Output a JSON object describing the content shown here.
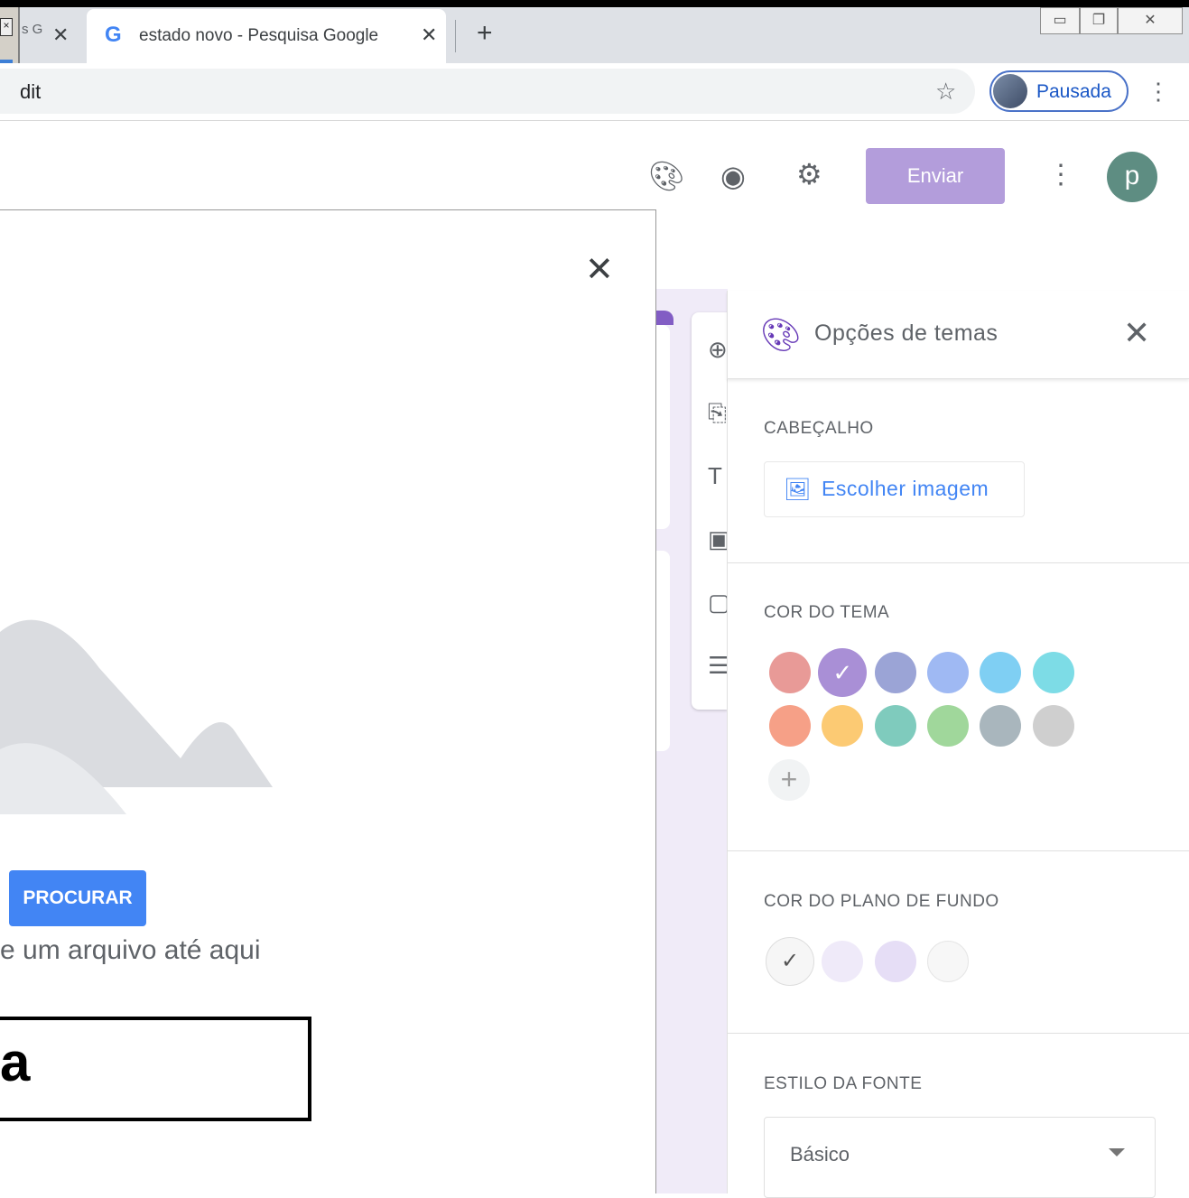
{
  "browser": {
    "tabs": [
      {
        "title_fragment": "s G"
      },
      {
        "title": "estado novo - Pesquisa Google"
      }
    ],
    "url_fragment": "dit",
    "profile_label": "Pausada"
  },
  "forms_header": {
    "send_label": "Enviar",
    "avatar_letter": "p"
  },
  "upload_dialog": {
    "browse_label": "PROCURAR",
    "drag_text": "e um arquivo até aqui",
    "annotation_text": "a"
  },
  "theme_panel": {
    "title": "Opções de temas",
    "header_section": {
      "label": "CABEÇALHO",
      "choose_image_label": "Escolher imagem"
    },
    "theme_color_section": {
      "label": "COR DO TEMA",
      "colors": [
        "#e89a97",
        "#a98fd6",
        "#9ba4d6",
        "#9fb9f3",
        "#7fcff3",
        "#7ddce6",
        "#f6a087",
        "#fcca73",
        "#7fcbbd",
        "#a0d79b",
        "#a9b6bd",
        "#cfcfcf"
      ],
      "selected_index": 1
    },
    "background_section": {
      "label": "COR DO PLANO DE FUNDO",
      "colors": [
        "#f6f6f6",
        "#efeaf9",
        "#e6def6",
        "#f7f7f7"
      ],
      "selected_index": 0
    },
    "font_section": {
      "label": "ESTILO DA FONTE",
      "selected_font": "Básico"
    }
  },
  "icons": {
    "header": [
      "palette-icon",
      "eye-icon",
      "gear-icon",
      "kebab-icon"
    ],
    "toolbar": [
      "add-question-icon",
      "import-icon",
      "title-icon",
      "image-icon",
      "video-icon",
      "section-icon"
    ]
  }
}
